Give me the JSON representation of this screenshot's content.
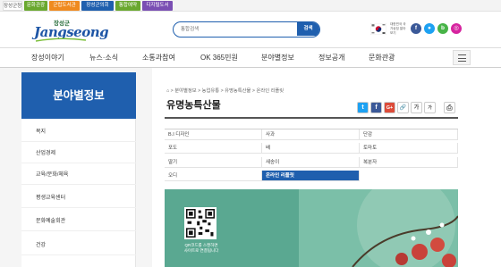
{
  "top_tabs": [
    {
      "label": "장성군청",
      "color": "#3b79c2"
    },
    {
      "label": "문화관광",
      "color": "#6aa82f"
    },
    {
      "label": "군립도서관",
      "color": "#ef8a1f"
    },
    {
      "label": "장성군의회",
      "color": "#1f5fae"
    },
    {
      "label": "통합예약",
      "color": "#6aa82f"
    },
    {
      "label": "디지털도서",
      "color": "#7a4fb3"
    }
  ],
  "logo": {
    "small": "장성군",
    "main": "Jangseong"
  },
  "search": {
    "placeholder": "통합검색",
    "button": "검색"
  },
  "flag_text": "대한민국 국가상징 알아보기",
  "sns": [
    {
      "label": "f",
      "color": "#3b5998"
    },
    {
      "label": "●",
      "color": "#1da1f2"
    },
    {
      "label": "b",
      "color": "#47b347"
    },
    {
      "label": "◎",
      "color": "#d6249f"
    }
  ],
  "gnb": [
    "장성이야기",
    "뉴스·소식",
    "소통과참여",
    "OK 365민원",
    "분야별정보",
    "정보공개",
    "문화관광"
  ],
  "sidebar": {
    "title": "분야별정보",
    "items": [
      "복지",
      "산업경제",
      "교육/문화/체육",
      "평생교육센터",
      "문화예술회관",
      "건강"
    ]
  },
  "breadcrumb": "⌂ > 분야별정보 > 농업유통 > 유명농특산물 > 온라인 리플릿",
  "page_title": "유명농특산물",
  "tools": [
    {
      "label": "t",
      "color": "#1da1f2"
    },
    {
      "label": "f",
      "color": "#3b5998"
    },
    {
      "label": "G+",
      "color": "#dd4b39"
    },
    {
      "label": "🔗",
      "color": "#999999"
    },
    {
      "label": "가",
      "color": "#888888"
    },
    {
      "label": "가",
      "color": "#888888"
    },
    {
      "label": "⎙",
      "color": "#666666"
    }
  ],
  "products": [
    [
      "B.I 디자인",
      "사과",
      "단감"
    ],
    [
      "포도",
      "배",
      "토마토"
    ],
    [
      "딸기",
      "새송이",
      "복분자"
    ],
    [
      "오디",
      "온라인 리플릿",
      ""
    ]
  ],
  "active_product": "온라인 리플릿",
  "banner": {
    "qr_text": "QR코드를 스캔하면 사이트로 연결됩니다"
  }
}
